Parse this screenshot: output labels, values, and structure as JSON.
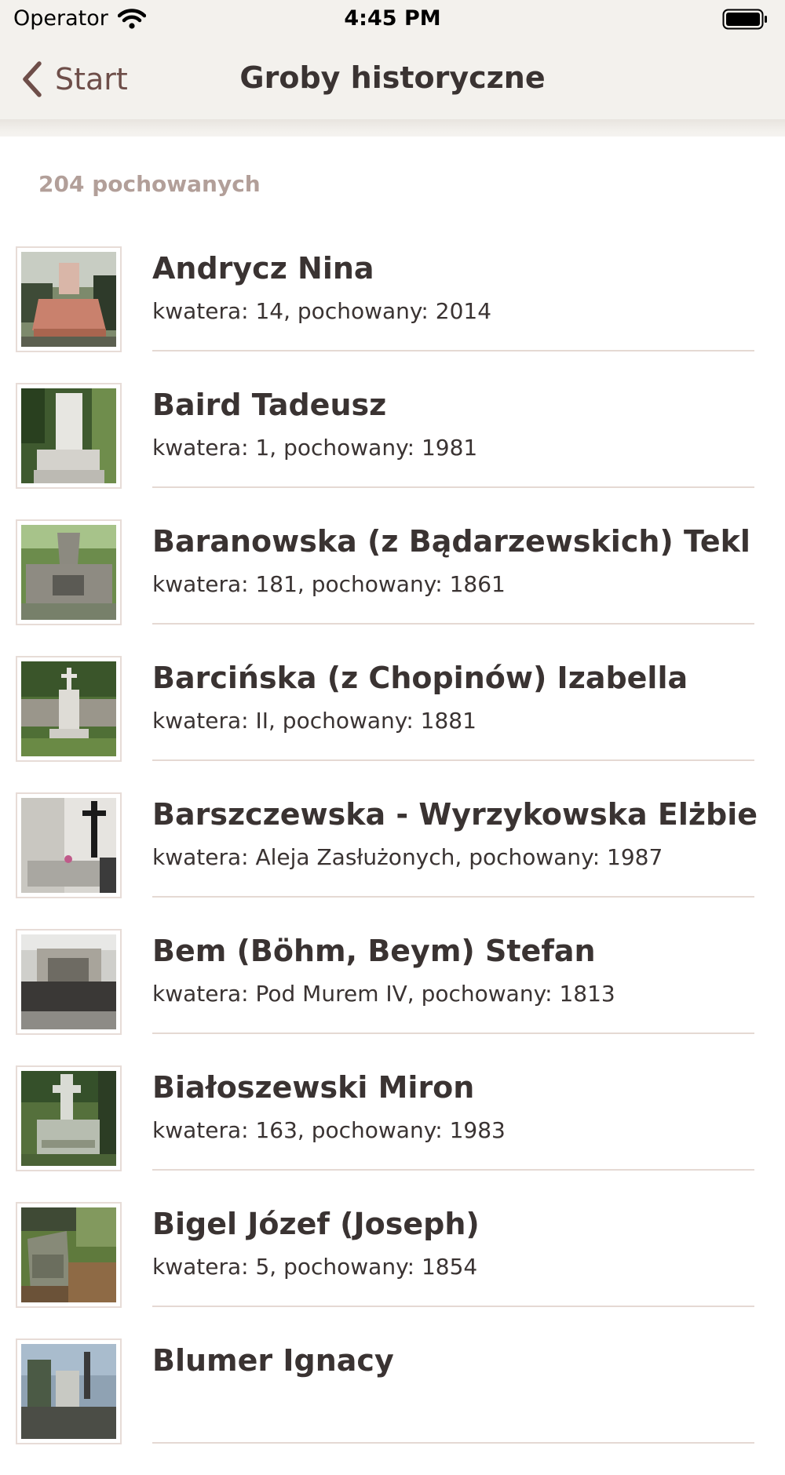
{
  "status_bar": {
    "carrier": "Operator",
    "time": "4:45 PM",
    "wifi_icon": "wifi-icon",
    "battery_icon": "battery-full-icon"
  },
  "nav": {
    "back_label": "Start",
    "back_icon": "chevron-left-icon",
    "title": "Groby historyczne",
    "accent_color": "#6e4e49"
  },
  "count_label": "204 pochowanych",
  "items": [
    {
      "name": "Andrycz Nina",
      "meta": "kwatera: 14, pochowany: 2014"
    },
    {
      "name": "Baird Tadeusz",
      "meta": "kwatera: 1, pochowany: 1981"
    },
    {
      "name": "Baranowska (z Bądarzewskich)  Tekl",
      "meta": "kwatera: 181, pochowany: 1861"
    },
    {
      "name": "Barcińska (z Chopinów) Izabella",
      "meta": "kwatera: II, pochowany: 1881"
    },
    {
      "name": "Barszczewska - Wyrzykowska Elżbie",
      "meta": "kwatera: Aleja Zasłużonych, pochowany: 1987"
    },
    {
      "name": "Bem (Böhm, Beym) Stefan",
      "meta": "kwatera: Pod Murem IV, pochowany: 1813"
    },
    {
      "name": "Białoszewski Miron",
      "meta": "kwatera: 163, pochowany: 1983"
    },
    {
      "name": "Bigel Józef (Joseph)",
      "meta": "kwatera: 5, pochowany: 1854"
    },
    {
      "name": "Blumer Ignacy",
      "meta": ""
    }
  ]
}
